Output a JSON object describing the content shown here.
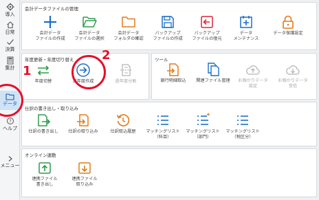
{
  "sidebar": {
    "items": [
      {
        "label": "導入",
        "icon": "gear-icon"
      },
      {
        "label": "日常",
        "icon": "home-icon"
      },
      {
        "label": "決算",
        "icon": "check-icon"
      },
      {
        "label": "集計",
        "icon": "calculator-icon"
      },
      {
        "label": "データ",
        "icon": "folder-icon"
      },
      {
        "label": "ヘルプ",
        "icon": "help-icon"
      },
      {
        "label": "メニュー",
        "icon": "chevron-right-icon"
      }
    ]
  },
  "panels": {
    "file_management": {
      "title": "会計データファイルの管理",
      "tools": [
        {
          "label": "会計データ\nファイルの作成",
          "icon": "plus-icon"
        },
        {
          "label": "会計データ\nファイルの選択",
          "icon": "folder-open-icon"
        },
        {
          "label": "会計データ\nフォルダの確認",
          "icon": "folder-icon"
        },
        {
          "label": "バックアップ\nファイルの作成",
          "icon": "save-icon"
        },
        {
          "label": "バックアップ\nファイルの復元",
          "icon": "restore-icon"
        },
        {
          "label": "データ\nメンテナンス",
          "icon": "maintenance-icon"
        },
        {
          "label": "データ保護設定",
          "icon": "lock-icon"
        }
      ]
    },
    "year_update": {
      "title": "年度更新・年度切り替え",
      "tools": [
        {
          "label": "年度切替",
          "icon": "switch-arrows-icon"
        },
        {
          "label": "次年度作成",
          "icon": "arrow-right-circle-icon"
        },
        {
          "label": "過年度分割",
          "icon": "split-icon"
        }
      ]
    },
    "tools": {
      "title": "ツール",
      "tools": [
        {
          "label": "銀行明細取込",
          "icon": "bank-import-icon"
        },
        {
          "label": "関連ファイル管理",
          "icon": "related-files-icon"
        },
        {
          "label": "お預かりデータ\n設定",
          "icon": "cloud-upload-icon"
        },
        {
          "label": "お預かりデータ\n受信",
          "icon": "cloud-download-icon"
        }
      ]
    },
    "journal_io": {
      "title": "仕訳の書き出し・取り込み",
      "tools": [
        {
          "label": "仕訳の書き出し",
          "icon": "export-icon"
        },
        {
          "label": "仕訳の取り込み",
          "icon": "import-icon"
        },
        {
          "label": "仕訳取込履歴",
          "icon": "history-icon"
        },
        {
          "label": "マッチングリスト\n（科目）",
          "icon": "list-icon"
        },
        {
          "label": "マッチングリスト\n（部門）",
          "icon": "list-icon"
        },
        {
          "label": "マッチングリスト\n（税区分）",
          "icon": "list-icon"
        }
      ]
    },
    "online": {
      "title": "オンライン連動",
      "tools": [
        {
          "label": "連携ファイル\n書き出し",
          "icon": "link-export-icon"
        },
        {
          "label": "連携ファイル\n取り込み",
          "icon": "link-import-icon"
        }
      ]
    }
  },
  "annotations": {
    "step1": "1",
    "step2": "2"
  },
  "colors": {
    "accent": "#1a6fc4",
    "orange": "#e07b1a",
    "green": "#2e9b4a",
    "red": "#d9263a",
    "annotation": "#e3102a",
    "disabled": "#b5b5b5"
  }
}
